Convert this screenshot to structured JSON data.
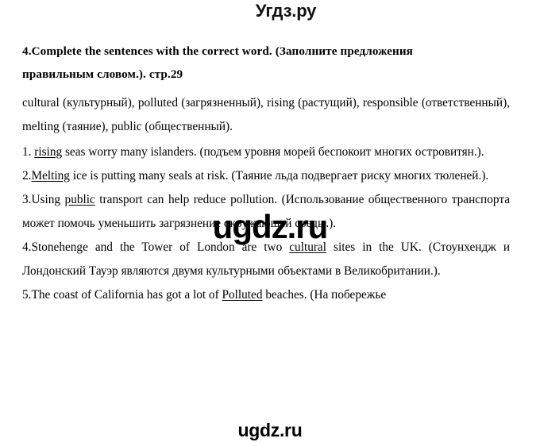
{
  "site": {
    "header_logo": "Угдз.ру",
    "watermark_main": "ugdz.ru",
    "watermark_footer": "ugdz.ru"
  },
  "exercise": {
    "number": "4.",
    "title_line_1": "4.Complete the sentences with the correct word. (Заполните предложения",
    "title_line_2": "правильным словом.). стр.29",
    "title_full": "4.Complete the sentences with the correct word. (Заполните предложения правильным словом.). стр.29",
    "page_reference": "стр.29"
  },
  "word_bank": {
    "text": "cultural (культурный), polluted (загрязненный), rising (растущий), responsible (ответственный), melting (таяние), public (общественный).",
    "words": [
      {
        "en": "cultural",
        "ru": "культурный"
      },
      {
        "en": "polluted",
        "ru": "загрязненный"
      },
      {
        "en": "rising",
        "ru": "растущий"
      },
      {
        "en": "responsible",
        "ru": "ответственный"
      },
      {
        "en": "melting",
        "ru": "таяние"
      },
      {
        "en": "public",
        "ru": "общественный"
      }
    ]
  },
  "answers": [
    {
      "num": "1. ",
      "before": "",
      "answer": "rising",
      "after": " seas worry many islanders. (подъем уровня морей беспокоит многих островитян.).",
      "translation": "подъем уровня морей беспокоит многих островитян."
    },
    {
      "num": "2.",
      "before": "",
      "answer": "Melting",
      "after": " ice is putting many seals at risk. (Таяние льда подвергает риску многих тюленей.).",
      "translation": "Таяние льда подвергает риску многих тюленей."
    },
    {
      "num": "3.",
      "before": "Using ",
      "answer": "public",
      "after": " transport can help reduce pollution. (Использование общественного транспорта может помочь уменьшить загрязнение окружающей среды.).",
      "translation": "Использование общественного транспорта может помочь уменьшить загрязнение окружающей среды."
    },
    {
      "num": "4.",
      "before": "Stonehenge and the Tower of London are two ",
      "answer": "cultural",
      "after": " sites in the UK. (Стоунхендж и Лондонский Тауэр являются двумя культурными объектами в Великобритании.).",
      "translation": "Стоунхендж и Лондонский Тауэр являются двумя культурными объектами в Великобритании."
    },
    {
      "num": "5.",
      "before": "The coast of California has got a lot of ",
      "answer": "Polluted",
      "after": " beaches. (На побережье",
      "translation": "На побережье"
    }
  ]
}
